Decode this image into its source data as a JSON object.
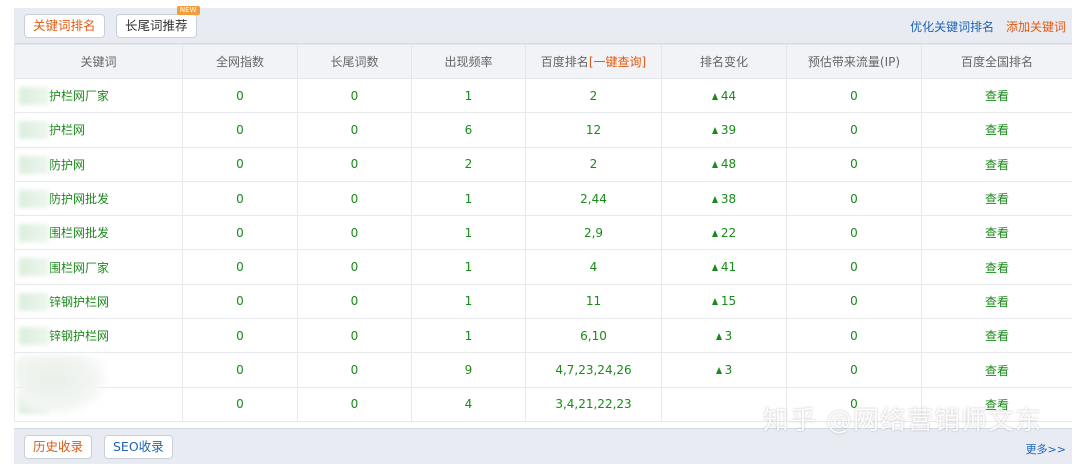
{
  "top": {
    "tab_active": "关键词排名",
    "tab_longtail": "长尾词推荐",
    "new_badge": "NEW",
    "link_optimize": "优化关键词排名",
    "link_add": "添加关键词"
  },
  "table": {
    "headers": {
      "keyword": "关键词",
      "index": "全网指数",
      "longtail": "长尾词数",
      "freq": "出现频率",
      "baidu_rank": "百度排名",
      "oneclick": "[一键查询]",
      "change": "排名变化",
      "traffic": "预估带来流量(IP)",
      "national": "百度全国排名"
    },
    "rows": [
      {
        "keyword": "护栏网厂家",
        "index": "0",
        "longtail": "0",
        "freq": "1",
        "rank": "2",
        "change": "44",
        "traffic": "0",
        "view": "查看"
      },
      {
        "keyword": "护栏网",
        "index": "0",
        "longtail": "0",
        "freq": "6",
        "rank": "12",
        "change": "39",
        "traffic": "0",
        "view": "查看"
      },
      {
        "keyword": "防护网",
        "index": "0",
        "longtail": "0",
        "freq": "2",
        "rank": "2",
        "change": "48",
        "traffic": "0",
        "view": "查看"
      },
      {
        "keyword": "防护网批发",
        "index": "0",
        "longtail": "0",
        "freq": "1",
        "rank": "2,44",
        "change": "38",
        "traffic": "0",
        "view": "查看"
      },
      {
        "keyword": "围栏网批发",
        "index": "0",
        "longtail": "0",
        "freq": "1",
        "rank": "2,9",
        "change": "22",
        "traffic": "0",
        "view": "查看"
      },
      {
        "keyword": "围栏网厂家",
        "index": "0",
        "longtail": "0",
        "freq": "1",
        "rank": "4",
        "change": "41",
        "traffic": "0",
        "view": "查看"
      },
      {
        "keyword": "锌钢护栏网",
        "index": "0",
        "longtail": "0",
        "freq": "1",
        "rank": "11",
        "change": "15",
        "traffic": "0",
        "view": "查看"
      },
      {
        "keyword": "锌钢护栏网",
        "index": "0",
        "longtail": "0",
        "freq": "1",
        "rank": "6,10",
        "change": "3",
        "traffic": "0",
        "view": "查看"
      },
      {
        "keyword": "",
        "index": "0",
        "longtail": "0",
        "freq": "9",
        "rank": "4,7,23,24,26",
        "change": "3",
        "traffic": "0",
        "view": "查看"
      },
      {
        "keyword": "",
        "index": "0",
        "longtail": "0",
        "freq": "4",
        "rank": "3,4,21,22,23",
        "change": "",
        "traffic": "0",
        "view": "查看"
      }
    ]
  },
  "bottom": {
    "tab_history": "历史收录",
    "tab_seo": "SEO收录",
    "more": "更多>>"
  },
  "watermark": "知乎 @网络营销师文东"
}
